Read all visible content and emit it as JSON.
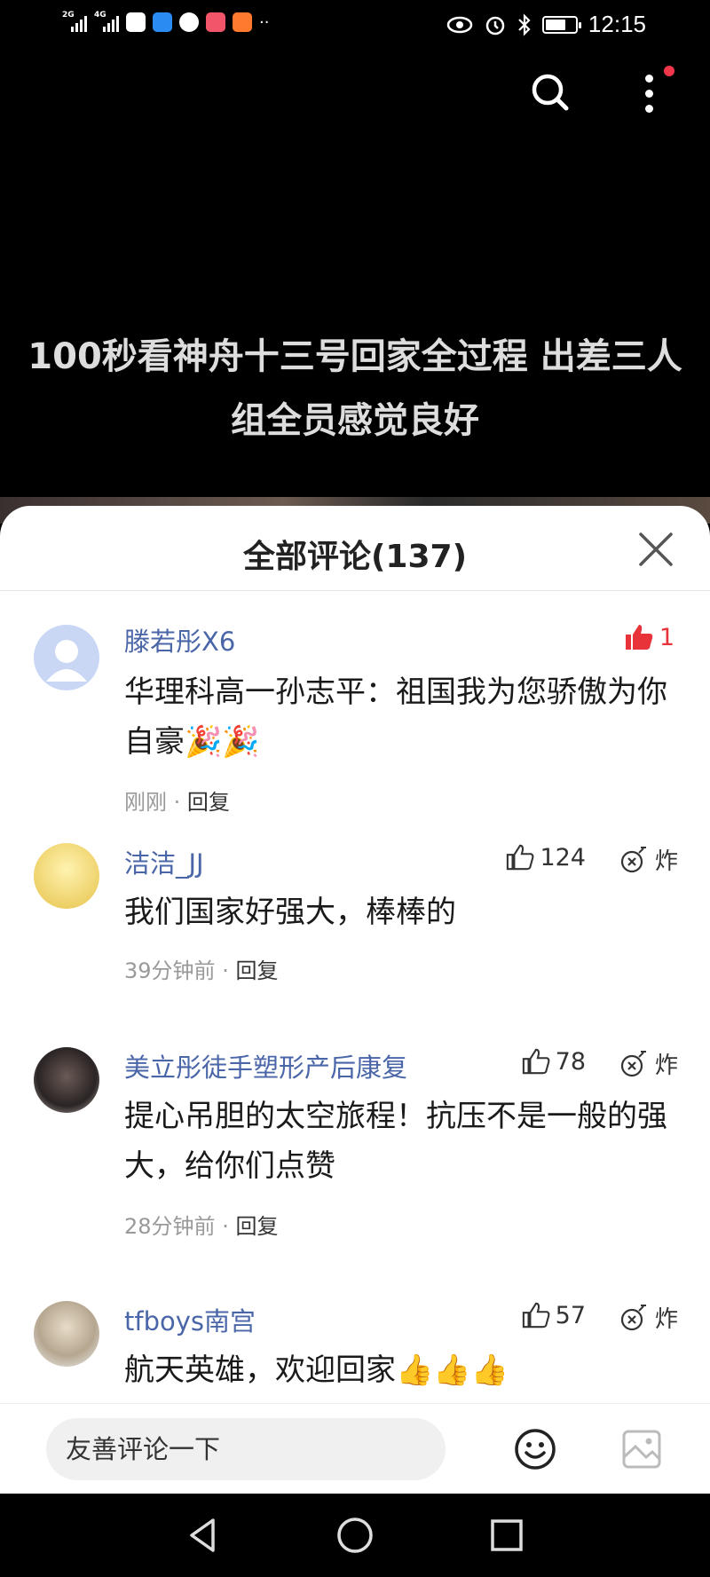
{
  "status_bar": {
    "network1": "2G",
    "network2": "4G",
    "time": "12:15",
    "battery_level": 0.7
  },
  "video": {
    "title": "100秒看神舟十三号回家全过程 出差三人组全员感觉良好"
  },
  "comments_panel": {
    "title": "全部评论(137)",
    "comments": [
      {
        "username": "滕若彤X6",
        "text": "华理科高一孙志平：祖国我为您骄傲为你自豪🎉🎉",
        "time": "刚刚",
        "reply_label": "回复",
        "likes": "1",
        "liked": true
      },
      {
        "username": "洁洁_JJ",
        "text": "我们国家好强大，棒棒的",
        "time": "39分钟前",
        "reply_label": "回复",
        "likes": "124",
        "bomb_label": "炸"
      },
      {
        "username": "美立彤徒手塑形产后康复",
        "text": "提心吊胆的太空旅程！抗压不是一般的强大，给你们点赞",
        "time": "28分钟前",
        "reply_label": "回复",
        "likes": "78",
        "bomb_label": "炸"
      },
      {
        "username": "tfboys南宫",
        "text": "航天英雄，欢迎回家👍👍👍",
        "likes": "57",
        "bomb_label": "炸"
      }
    ]
  },
  "input_bar": {
    "placeholder": "友善评论一下"
  },
  "colors": {
    "username": "#4a66a8",
    "liked_red": "#e8333b",
    "accent_dot": "#f2374b"
  }
}
